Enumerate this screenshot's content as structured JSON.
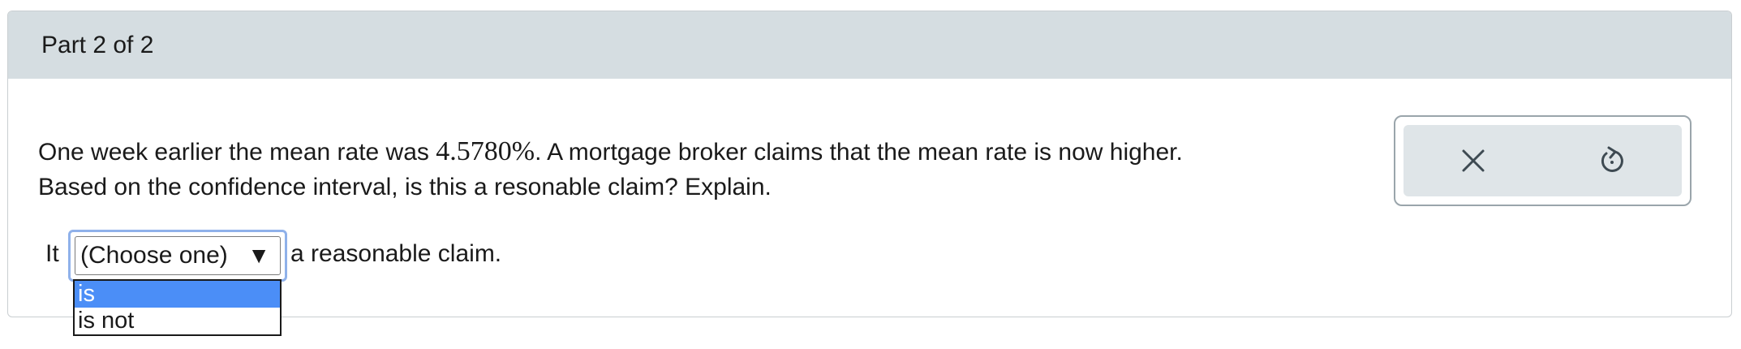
{
  "header": {
    "title": "Part 2 of 2"
  },
  "question": {
    "line1_before": "One week earlier the mean rate was ",
    "mean_rate": "4.5780%",
    "line1_after": ". A mortgage broker claims that the mean rate is now higher.",
    "line2": "Based on the confidence interval, is this a resonable claim? Explain."
  },
  "answer": {
    "prefix": "It",
    "select_value": "(Choose one)",
    "arrow_glyph": "▼",
    "suffix": "a reasonable claim.",
    "options": [
      "is",
      "is not"
    ],
    "highlighted_option": "is"
  },
  "tools": {
    "clear_icon": "x-icon",
    "undo_icon": "undo-icon"
  },
  "colors": {
    "header_bg": "#d5dde1",
    "focus_ring": "#8fb1ea",
    "option_highlight": "#4b8ef7",
    "tools_bg": "#dfe5e8"
  }
}
